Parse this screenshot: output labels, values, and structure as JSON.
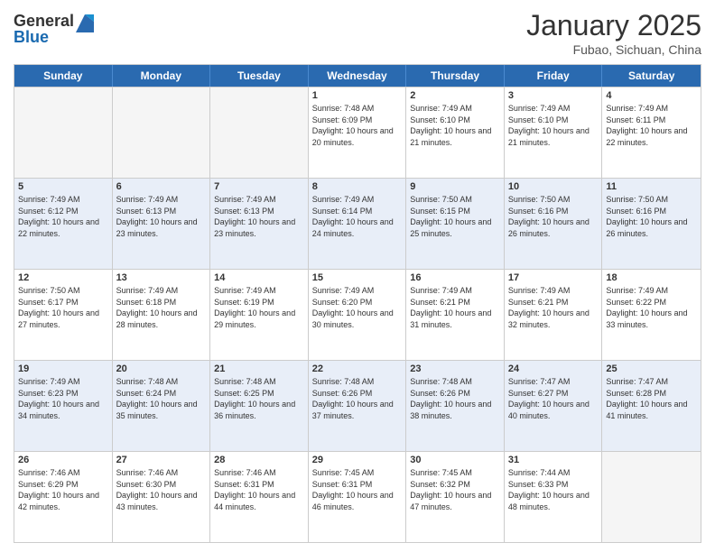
{
  "logo": {
    "general": "General",
    "blue": "Blue"
  },
  "title": "January 2025",
  "subtitle": "Fubao, Sichuan, China",
  "headers": [
    "Sunday",
    "Monday",
    "Tuesday",
    "Wednesday",
    "Thursday",
    "Friday",
    "Saturday"
  ],
  "weeks": [
    [
      {
        "day": "",
        "info": ""
      },
      {
        "day": "",
        "info": ""
      },
      {
        "day": "",
        "info": ""
      },
      {
        "day": "1",
        "info": "Sunrise: 7:48 AM\nSunset: 6:09 PM\nDaylight: 10 hours and 20 minutes."
      },
      {
        "day": "2",
        "info": "Sunrise: 7:49 AM\nSunset: 6:10 PM\nDaylight: 10 hours and 21 minutes."
      },
      {
        "day": "3",
        "info": "Sunrise: 7:49 AM\nSunset: 6:10 PM\nDaylight: 10 hours and 21 minutes."
      },
      {
        "day": "4",
        "info": "Sunrise: 7:49 AM\nSunset: 6:11 PM\nDaylight: 10 hours and 22 minutes."
      }
    ],
    [
      {
        "day": "5",
        "info": "Sunrise: 7:49 AM\nSunset: 6:12 PM\nDaylight: 10 hours and 22 minutes."
      },
      {
        "day": "6",
        "info": "Sunrise: 7:49 AM\nSunset: 6:13 PM\nDaylight: 10 hours and 23 minutes."
      },
      {
        "day": "7",
        "info": "Sunrise: 7:49 AM\nSunset: 6:13 PM\nDaylight: 10 hours and 23 minutes."
      },
      {
        "day": "8",
        "info": "Sunrise: 7:49 AM\nSunset: 6:14 PM\nDaylight: 10 hours and 24 minutes."
      },
      {
        "day": "9",
        "info": "Sunrise: 7:50 AM\nSunset: 6:15 PM\nDaylight: 10 hours and 25 minutes."
      },
      {
        "day": "10",
        "info": "Sunrise: 7:50 AM\nSunset: 6:16 PM\nDaylight: 10 hours and 26 minutes."
      },
      {
        "day": "11",
        "info": "Sunrise: 7:50 AM\nSunset: 6:16 PM\nDaylight: 10 hours and 26 minutes."
      }
    ],
    [
      {
        "day": "12",
        "info": "Sunrise: 7:50 AM\nSunset: 6:17 PM\nDaylight: 10 hours and 27 minutes."
      },
      {
        "day": "13",
        "info": "Sunrise: 7:49 AM\nSunset: 6:18 PM\nDaylight: 10 hours and 28 minutes."
      },
      {
        "day": "14",
        "info": "Sunrise: 7:49 AM\nSunset: 6:19 PM\nDaylight: 10 hours and 29 minutes."
      },
      {
        "day": "15",
        "info": "Sunrise: 7:49 AM\nSunset: 6:20 PM\nDaylight: 10 hours and 30 minutes."
      },
      {
        "day": "16",
        "info": "Sunrise: 7:49 AM\nSunset: 6:21 PM\nDaylight: 10 hours and 31 minutes."
      },
      {
        "day": "17",
        "info": "Sunrise: 7:49 AM\nSunset: 6:21 PM\nDaylight: 10 hours and 32 minutes."
      },
      {
        "day": "18",
        "info": "Sunrise: 7:49 AM\nSunset: 6:22 PM\nDaylight: 10 hours and 33 minutes."
      }
    ],
    [
      {
        "day": "19",
        "info": "Sunrise: 7:49 AM\nSunset: 6:23 PM\nDaylight: 10 hours and 34 minutes."
      },
      {
        "day": "20",
        "info": "Sunrise: 7:48 AM\nSunset: 6:24 PM\nDaylight: 10 hours and 35 minutes."
      },
      {
        "day": "21",
        "info": "Sunrise: 7:48 AM\nSunset: 6:25 PM\nDaylight: 10 hours and 36 minutes."
      },
      {
        "day": "22",
        "info": "Sunrise: 7:48 AM\nSunset: 6:26 PM\nDaylight: 10 hours and 37 minutes."
      },
      {
        "day": "23",
        "info": "Sunrise: 7:48 AM\nSunset: 6:26 PM\nDaylight: 10 hours and 38 minutes."
      },
      {
        "day": "24",
        "info": "Sunrise: 7:47 AM\nSunset: 6:27 PM\nDaylight: 10 hours and 40 minutes."
      },
      {
        "day": "25",
        "info": "Sunrise: 7:47 AM\nSunset: 6:28 PM\nDaylight: 10 hours and 41 minutes."
      }
    ],
    [
      {
        "day": "26",
        "info": "Sunrise: 7:46 AM\nSunset: 6:29 PM\nDaylight: 10 hours and 42 minutes."
      },
      {
        "day": "27",
        "info": "Sunrise: 7:46 AM\nSunset: 6:30 PM\nDaylight: 10 hours and 43 minutes."
      },
      {
        "day": "28",
        "info": "Sunrise: 7:46 AM\nSunset: 6:31 PM\nDaylight: 10 hours and 44 minutes."
      },
      {
        "day": "29",
        "info": "Sunrise: 7:45 AM\nSunset: 6:31 PM\nDaylight: 10 hours and 46 minutes."
      },
      {
        "day": "30",
        "info": "Sunrise: 7:45 AM\nSunset: 6:32 PM\nDaylight: 10 hours and 47 minutes."
      },
      {
        "day": "31",
        "info": "Sunrise: 7:44 AM\nSunset: 6:33 PM\nDaylight: 10 hours and 48 minutes."
      },
      {
        "day": "",
        "info": ""
      }
    ]
  ]
}
